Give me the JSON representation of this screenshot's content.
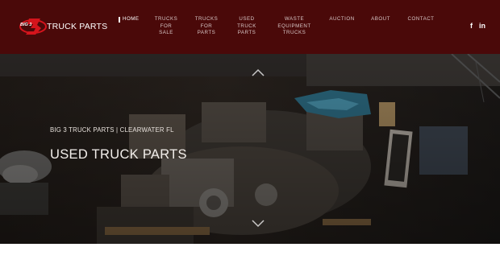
{
  "logo": {
    "mark_text": "BIG 3",
    "name": "TRUCK PARTS"
  },
  "nav": [
    {
      "label": "HOME",
      "active": true
    },
    {
      "label": "TRUCKS\nFOR\nSALE"
    },
    {
      "label": "TRUCKS\nFOR\nPARTS"
    },
    {
      "label": "USED\nTRUCK\nPARTS"
    },
    {
      "label": "WASTE\nEQUIPMENT\nTRUCKS"
    },
    {
      "label": "AUCTION"
    },
    {
      "label": "ABOUT"
    },
    {
      "label": "CONTACT"
    }
  ],
  "social": [
    {
      "icon": "facebook-icon",
      "glyph": "f"
    },
    {
      "icon": "linkedin-icon",
      "glyph": "in"
    }
  ],
  "hero": {
    "subtitle": "BIG 3 TRUCK PARTS | CLEARWATER FL",
    "title": "USED TRUCK PARTS"
  },
  "colors": {
    "header_bg": "#4a0909",
    "accent": "#c0141b"
  }
}
